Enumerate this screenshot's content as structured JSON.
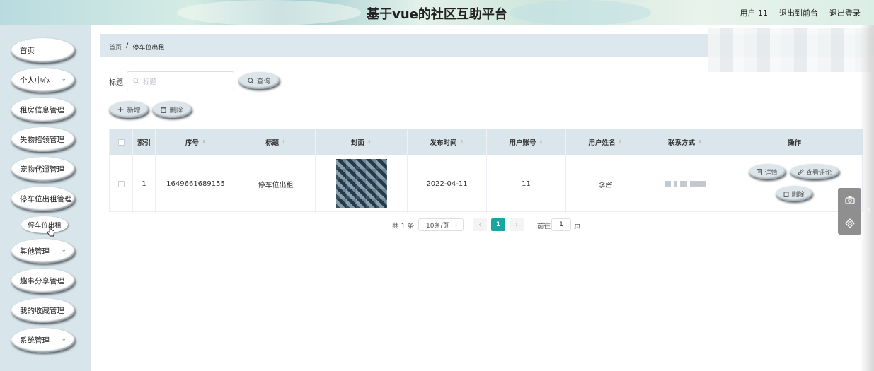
{
  "header": {
    "title": "基于vue的社区互助平台",
    "user_label": "用户 11",
    "back_front": "退出到前台",
    "logout": "退出登录"
  },
  "sidebar": {
    "items": [
      {
        "label": "首页",
        "expandable": false
      },
      {
        "label": "个人中心",
        "expandable": true
      },
      {
        "label": "租房信息管理",
        "expandable": false
      },
      {
        "label": "失物招领管理",
        "expandable": false
      },
      {
        "label": "宠物代遛管理",
        "expandable": false
      },
      {
        "label": "停车位出租管理",
        "expandable": false
      },
      {
        "label": "其他管理",
        "expandable": true
      },
      {
        "label": "趣事分享管理",
        "expandable": false
      },
      {
        "label": "我的收藏管理",
        "expandable": false
      },
      {
        "label": "系统管理",
        "expandable": true
      }
    ],
    "active_sub": "停车位出租"
  },
  "breadcrumb": {
    "home": "首页",
    "separator": "/",
    "current": "停车位出租"
  },
  "search": {
    "label": "标题",
    "placeholder": "标题",
    "query_button": "查询"
  },
  "actions": {
    "add": "新增",
    "delete": "删除"
  },
  "table": {
    "columns": [
      "索引",
      "序号",
      "标题",
      "封面",
      "发布时间",
      "用户账号",
      "用户姓名",
      "联系方式",
      "操作"
    ],
    "rows": [
      {
        "index": "1",
        "serial": "1649661689155",
        "title": "停车位出租",
        "publish_time": "2022-04-11",
        "account": "11",
        "name": "李密",
        "detail_btn": "详情",
        "comments_btn": "查看评论",
        "delete_btn": "删除"
      }
    ]
  },
  "pagination": {
    "total": "共 1 条",
    "page_size": "10条/页",
    "current_page": "1",
    "goto_label": "前往",
    "goto_value": "1",
    "page_unit": "页"
  },
  "colors": {
    "sidebar_bg": "#d8e6ec",
    "accent": "#17a6a1",
    "table_header_bg": "#dae6ec"
  }
}
